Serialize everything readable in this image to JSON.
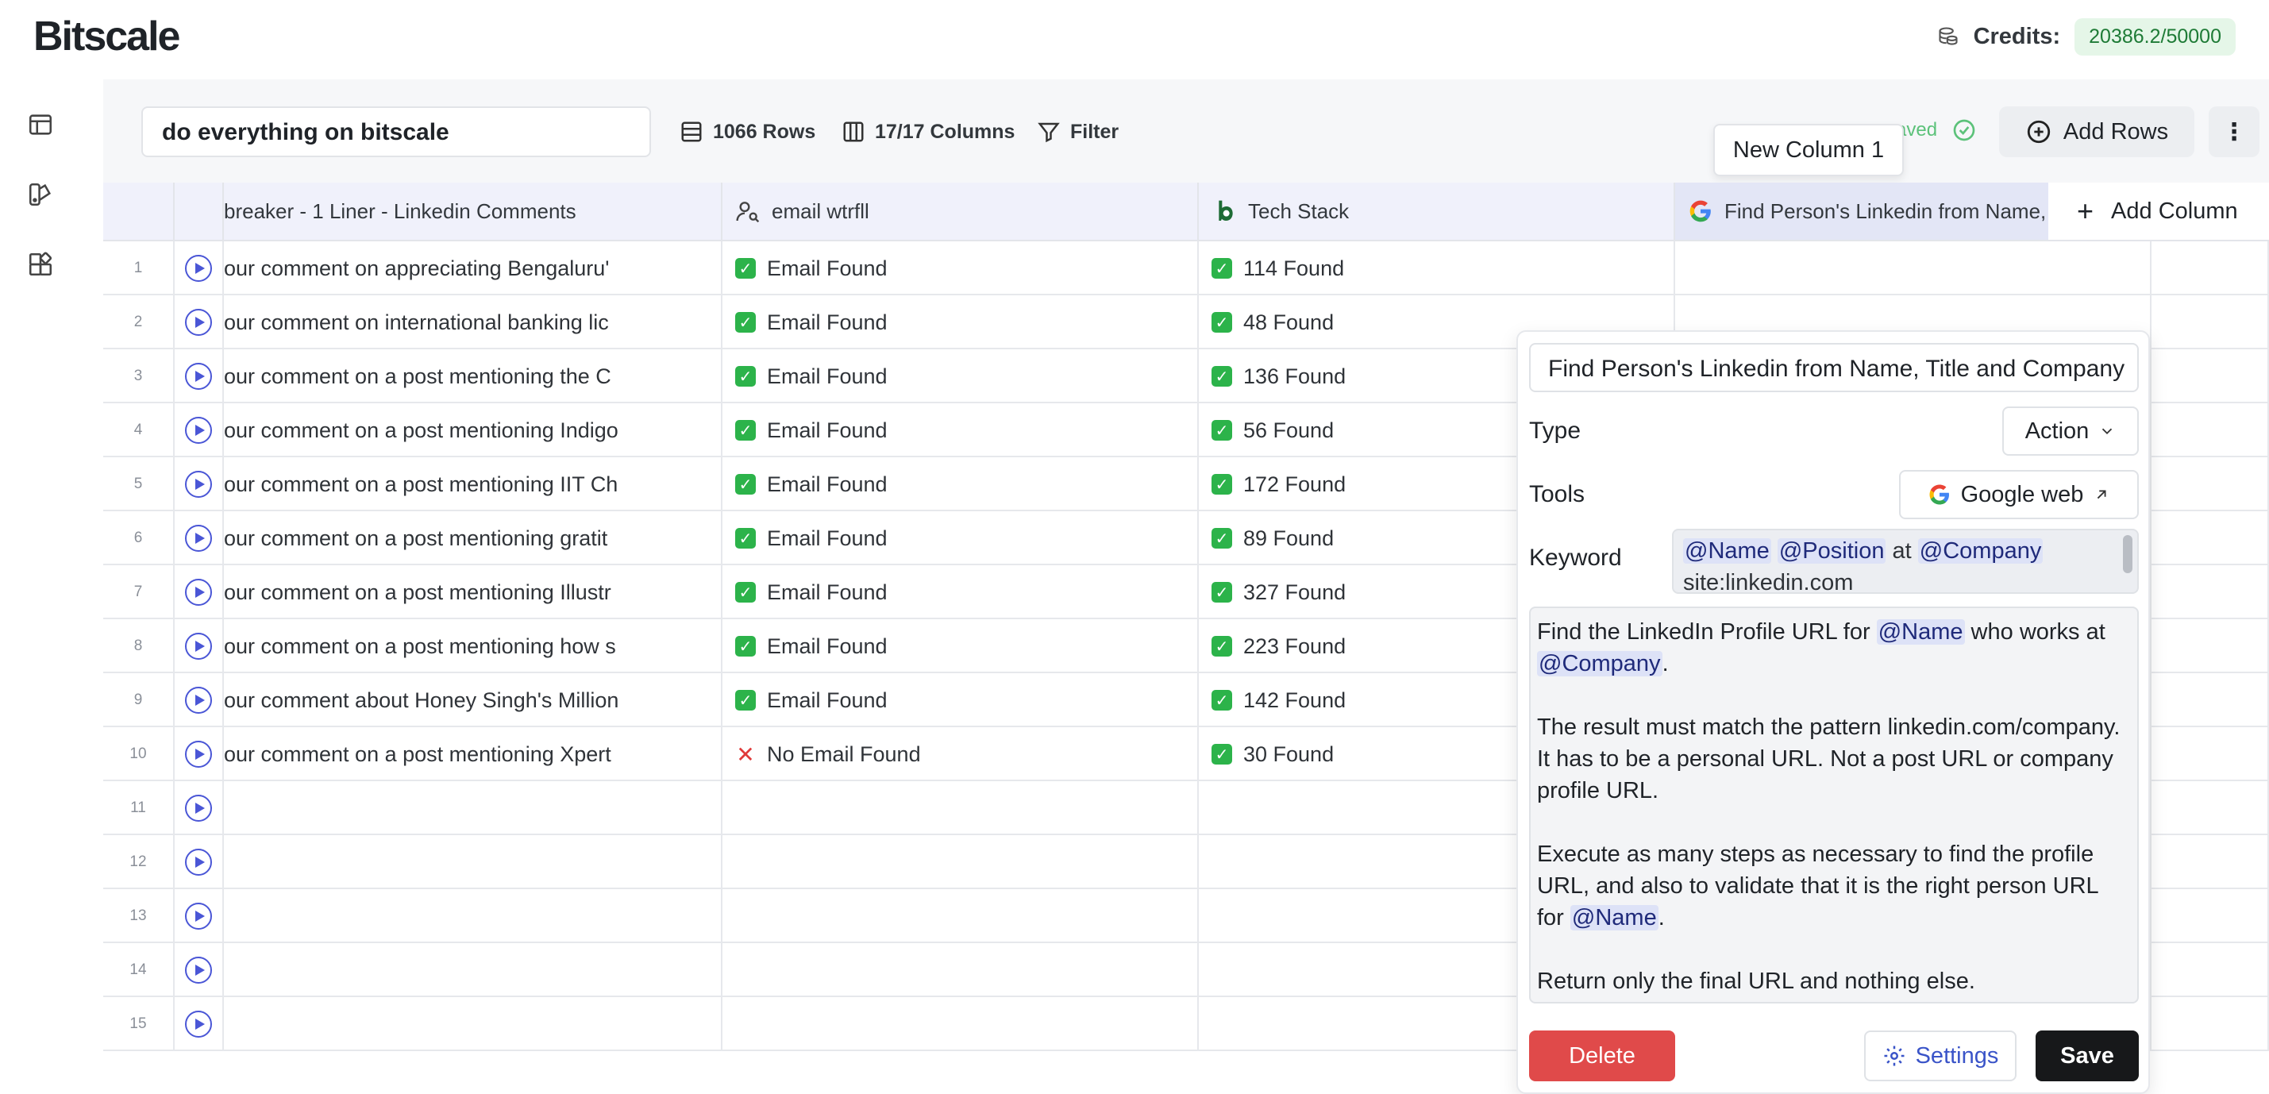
{
  "app": {
    "logo": "Bitscale"
  },
  "credits": {
    "label": "Credits:",
    "value": "20386.2/50000"
  },
  "sidebar": {
    "items": [
      {
        "icon": "table-icon"
      },
      {
        "icon": "palette-icon"
      },
      {
        "icon": "apps-icon"
      }
    ]
  },
  "toolbar": {
    "table_name": "do everything on bitscale",
    "rows_label": "1066 Rows",
    "columns_label": "17/17 Columns",
    "filter_label": "Filter",
    "saved_label": "aved",
    "add_rows_label": "Add Rows",
    "more_label": "⋮",
    "tooltip": "New Column 1"
  },
  "grid": {
    "headers": {
      "col1": "breaker - 1 Liner - Linkedin Comments",
      "col2": "email wtrfll",
      "col3": "Tech Stack",
      "col4": "Find Person's Linkedin from Name, Title",
      "add_column": "Add Column"
    },
    "rows": [
      {
        "idx": "1",
        "comment": "our comment on appreciating Bengaluru'",
        "email": "Email Found",
        "email_ok": true,
        "tech": "114 Found"
      },
      {
        "idx": "2",
        "comment": "our comment on international banking lic",
        "email": "Email Found",
        "email_ok": true,
        "tech": "48 Found"
      },
      {
        "idx": "3",
        "comment": "our comment on a post mentioning the C",
        "email": "Email Found",
        "email_ok": true,
        "tech": "136 Found"
      },
      {
        "idx": "4",
        "comment": "our comment on a post mentioning Indigo",
        "email": "Email Found",
        "email_ok": true,
        "tech": "56 Found"
      },
      {
        "idx": "5",
        "comment": "our comment on a post mentioning IIT Ch",
        "email": "Email Found",
        "email_ok": true,
        "tech": "172 Found"
      },
      {
        "idx": "6",
        "comment": "our comment on a post mentioning gratit",
        "email": "Email Found",
        "email_ok": true,
        "tech": "89 Found"
      },
      {
        "idx": "7",
        "comment": "our comment on a post mentioning Illustr",
        "email": "Email Found",
        "email_ok": true,
        "tech": "327 Found"
      },
      {
        "idx": "8",
        "comment": "our comment on a post mentioning how s",
        "email": "Email Found",
        "email_ok": true,
        "tech": "223 Found"
      },
      {
        "idx": "9",
        "comment": "our comment about Honey Singh's Million",
        "email": "Email Found",
        "email_ok": true,
        "tech": "142 Found"
      },
      {
        "idx": "10",
        "comment": "our comment on a post mentioning Xpert",
        "email": "No Email Found",
        "email_ok": false,
        "tech": "30 Found"
      },
      {
        "idx": "11",
        "comment": "",
        "email": "",
        "tech": ""
      },
      {
        "idx": "12",
        "comment": "",
        "email": "",
        "tech": ""
      },
      {
        "idx": "13",
        "comment": "",
        "email": "",
        "tech": ""
      },
      {
        "idx": "14",
        "comment": "",
        "email": "",
        "tech": ""
      },
      {
        "idx": "15",
        "comment": "",
        "email": "",
        "tech": ""
      }
    ]
  },
  "panel": {
    "title": "Find Person's Linkedin from Name, Title and Company",
    "type_label": "Type",
    "type_value": "Action",
    "tools_label": "Tools",
    "tools_value": "Google web",
    "keyword_label": "Keyword",
    "keyword": {
      "t1": "@Name",
      "t2": "@Position",
      "mid": " at ",
      "t3": "@Company",
      "rest": "site:linkedin.com"
    },
    "prompt": {
      "p1a": "Find the LinkedIn Profile URL for ",
      "p1tag1": "@Name",
      "p1b": " who works at ",
      "p1tag2": "@Company",
      "p1c": ".",
      "p2": "The result must match the pattern linkedin.com/company. It has to be a personal URL. Not a post URL or company profile URL.",
      "p3a": "Execute as many steps as necessary to find the profile URL, and also to validate that it is the right person URL for ",
      "p3tag": "@Name",
      "p3b": ".",
      "p4": "Return only the final URL and nothing else."
    },
    "delete_label": "Delete",
    "settings_label": "Settings",
    "save_label": "Save"
  },
  "colors": {
    "accent": "#4a56d6",
    "delete": "#e04a4a",
    "save": "#17181a",
    "credits_bg": "#e5f6e8",
    "header_bg": "#f0f1fb"
  }
}
